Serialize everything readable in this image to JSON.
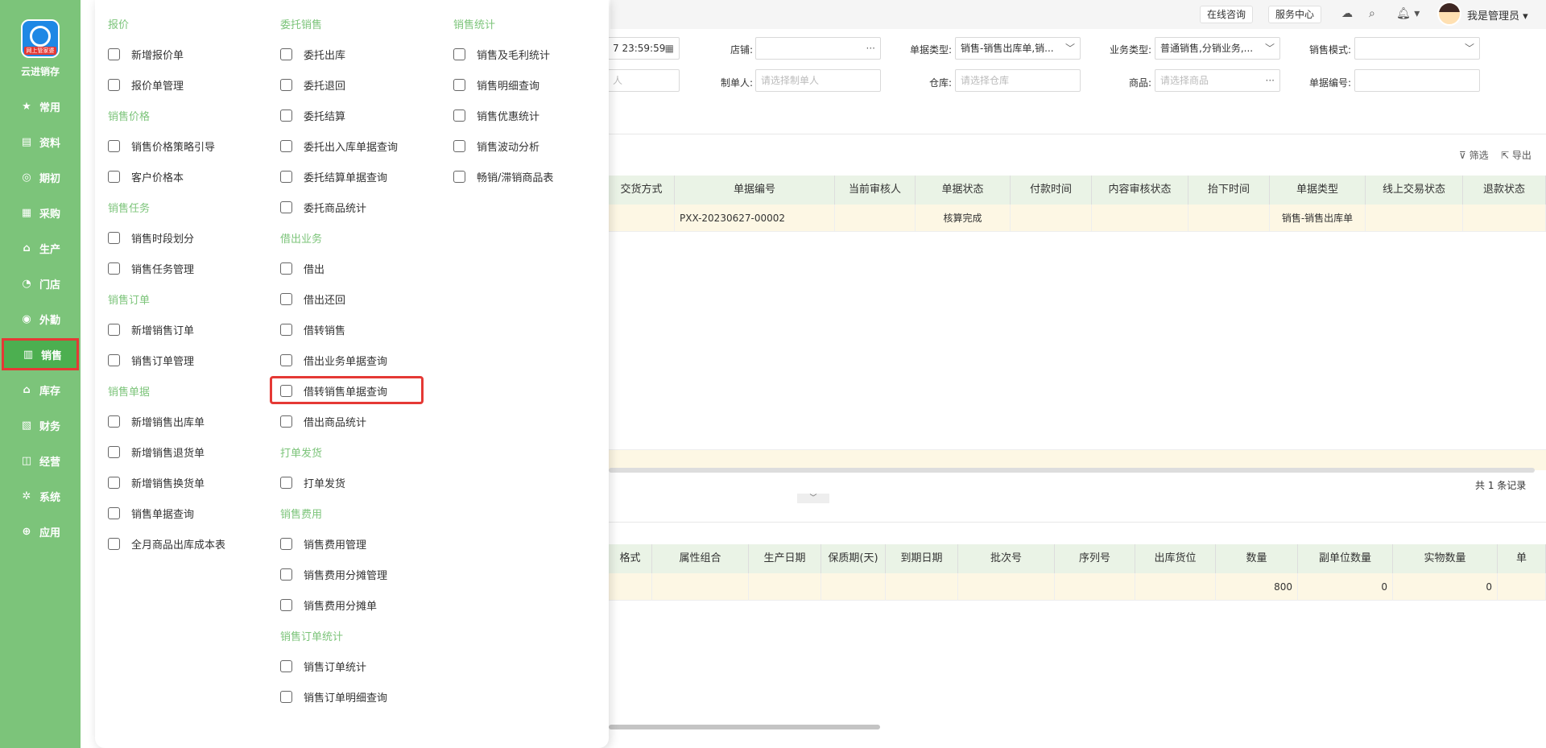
{
  "sidebar": {
    "logo_tag": "网上管家婆",
    "brand": "云进销存",
    "items": [
      {
        "label": "常用",
        "icon": "star-icon"
      },
      {
        "label": "资料",
        "icon": "document-icon"
      },
      {
        "label": "期初",
        "icon": "target-icon"
      },
      {
        "label": "采购",
        "icon": "cart-icon"
      },
      {
        "label": "生产",
        "icon": "factory-icon"
      },
      {
        "label": "门店",
        "icon": "pie-icon"
      },
      {
        "label": "外勤",
        "icon": "location-icon"
      },
      {
        "label": "销售",
        "icon": "chart-icon"
      },
      {
        "label": "库存",
        "icon": "warehouse-icon"
      },
      {
        "label": "财务",
        "icon": "finance-icon"
      },
      {
        "label": "经营",
        "icon": "trend-icon"
      },
      {
        "label": "系统",
        "icon": "gear-icon"
      },
      {
        "label": "应用",
        "icon": "plus-icon"
      }
    ],
    "active_index": 7
  },
  "topbar": {
    "online_consult": "在线咨询",
    "service_center": "服务中心",
    "user_name": "我是管理员"
  },
  "filters": {
    "date_end": "7 23:59:59",
    "shop_label": "店铺:",
    "shop_value": "",
    "doc_type_label": "单据类型:",
    "doc_type_value": "销售-销售出库单,销...",
    "biz_type_label": "业务类型:",
    "biz_type_value": "普通销售,分销业务,...",
    "sale_mode_label": "销售模式:",
    "sale_mode_value": "",
    "partial_left": "人",
    "maker_label": "制单人:",
    "maker_placeholder": "请选择制单人",
    "warehouse_label": "仓库:",
    "warehouse_placeholder": "请选择仓库",
    "goods_label": "商品:",
    "goods_placeholder": "请选择商品",
    "doc_no_label": "单据编号:",
    "doc_no_value": ""
  },
  "toolbar": {
    "filter_label": "筛选",
    "export_label": "导出"
  },
  "main_table": {
    "columns": [
      "交货方式",
      "单据编号",
      "当前审核人",
      "单据状态",
      "付款时间",
      "内容审核状态",
      "抬下时间",
      "单据类型",
      "线上交易状态",
      "退款状态"
    ],
    "rows": [
      [
        "",
        "PXX-20230627-00002",
        "",
        "核算完成",
        "",
        "",
        "",
        "销售-销售出库单",
        "",
        ""
      ]
    ],
    "total_text": "共 1 条记录"
  },
  "detail_table": {
    "columns": [
      "格式",
      "属性组合",
      "生产日期",
      "保质期(天)",
      "到期日期",
      "批次号",
      "序列号",
      "出库货位",
      "数量",
      "副单位数量",
      "实物数量",
      "单"
    ],
    "rows": [
      [
        "",
        "",
        "",
        "",
        "",
        "",
        "",
        "",
        "800",
        "0",
        "0",
        ""
      ]
    ]
  },
  "menu": {
    "col1": [
      {
        "type": "cat",
        "label": "报价"
      },
      {
        "type": "item",
        "label": "新增报价单"
      },
      {
        "type": "item",
        "label": "报价单管理"
      },
      {
        "type": "cat",
        "label": "销售价格"
      },
      {
        "type": "item",
        "label": "销售价格策略引导"
      },
      {
        "type": "item",
        "label": "客户价格本"
      },
      {
        "type": "cat",
        "label": "销售任务"
      },
      {
        "type": "item",
        "label": "销售时段划分"
      },
      {
        "type": "item",
        "label": "销售任务管理"
      },
      {
        "type": "cat",
        "label": "销售订单"
      },
      {
        "type": "item",
        "label": "新增销售订单"
      },
      {
        "type": "item",
        "label": "销售订单管理"
      },
      {
        "type": "cat",
        "label": "销售单据"
      },
      {
        "type": "item",
        "label": "新增销售出库单"
      },
      {
        "type": "item",
        "label": "新增销售退货单"
      },
      {
        "type": "item",
        "label": "新增销售换货单"
      },
      {
        "type": "item",
        "label": "销售单据查询"
      },
      {
        "type": "item",
        "label": "全月商品出库成本表"
      }
    ],
    "col2": [
      {
        "type": "cat",
        "label": "委托销售"
      },
      {
        "type": "item",
        "label": "委托出库"
      },
      {
        "type": "item",
        "label": "委托退回"
      },
      {
        "type": "item",
        "label": "委托结算"
      },
      {
        "type": "item",
        "label": "委托出入库单据查询"
      },
      {
        "type": "item",
        "label": "委托结算单据查询"
      },
      {
        "type": "item",
        "label": "委托商品统计"
      },
      {
        "type": "cat",
        "label": "借出业务"
      },
      {
        "type": "item",
        "label": "借出"
      },
      {
        "type": "item",
        "label": "借出还回"
      },
      {
        "type": "item",
        "label": "借转销售"
      },
      {
        "type": "item",
        "label": "借出业务单据查询"
      },
      {
        "type": "item",
        "label": "借转销售单据查询"
      },
      {
        "type": "item",
        "label": "借出商品统计"
      },
      {
        "type": "cat",
        "label": "打单发货"
      },
      {
        "type": "item",
        "label": "打单发货"
      },
      {
        "type": "cat",
        "label": "销售费用"
      },
      {
        "type": "item",
        "label": "销售费用管理"
      },
      {
        "type": "item",
        "label": "销售费用分摊管理"
      },
      {
        "type": "item",
        "label": "销售费用分摊单"
      },
      {
        "type": "cat",
        "label": "销售订单统计"
      },
      {
        "type": "item",
        "label": "销售订单统计"
      },
      {
        "type": "item",
        "label": "销售订单明细查询"
      }
    ],
    "col3": [
      {
        "type": "cat",
        "label": "销售统计"
      },
      {
        "type": "item",
        "label": "销售及毛利统计"
      },
      {
        "type": "item",
        "label": "销售明细查询"
      },
      {
        "type": "item",
        "label": "销售优惠统计"
      },
      {
        "type": "item",
        "label": "销售波动分析"
      },
      {
        "type": "item",
        "label": "畅销/滞销商品表"
      }
    ],
    "highlighted_item": "借转销售单据查询"
  },
  "colors": {
    "sidebar_bg": "#7cc47a",
    "accent_green": "#7cc47a",
    "highlight_red": "#e53935"
  }
}
